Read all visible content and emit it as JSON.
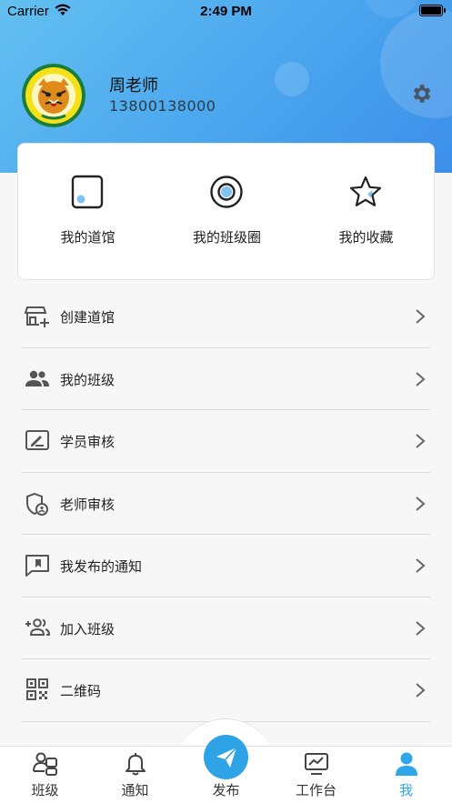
{
  "status_bar": {
    "carrier": "Carrier",
    "time": "2:49 PM"
  },
  "profile": {
    "name": "周老师",
    "phone": "13800138000",
    "avatar_icon": "tiger-logo-avatar",
    "settings_icon": "gear-icon"
  },
  "quick_actions": [
    {
      "label": "我的道馆",
      "icon": "square-app-icon"
    },
    {
      "label": "我的班级圈",
      "icon": "disc-icon"
    },
    {
      "label": "我的收藏",
      "icon": "star-icon"
    }
  ],
  "menu": [
    {
      "label": "创建道馆",
      "icon": "store-add-icon"
    },
    {
      "label": "我的班级",
      "icon": "people-icon"
    },
    {
      "label": "学员审核",
      "icon": "signature-icon"
    },
    {
      "label": "老师审核",
      "icon": "shield-user-icon"
    },
    {
      "label": "我发布的通知",
      "icon": "bookmark-message-icon"
    },
    {
      "label": "加入班级",
      "icon": "group-add-icon"
    },
    {
      "label": "二维码",
      "icon": "qrcode-icon"
    }
  ],
  "tabs": [
    {
      "label": "班级",
      "icon": "class-icon"
    },
    {
      "label": "通知",
      "icon": "bell-icon"
    },
    {
      "label": "发布",
      "icon": "send-icon"
    },
    {
      "label": "工作台",
      "icon": "dashboard-icon"
    },
    {
      "label": "我",
      "icon": "person-icon"
    }
  ],
  "colors": {
    "accent": "#2fa6e8",
    "header_start": "#63c0f0",
    "header_end": "#3c8fe9"
  }
}
